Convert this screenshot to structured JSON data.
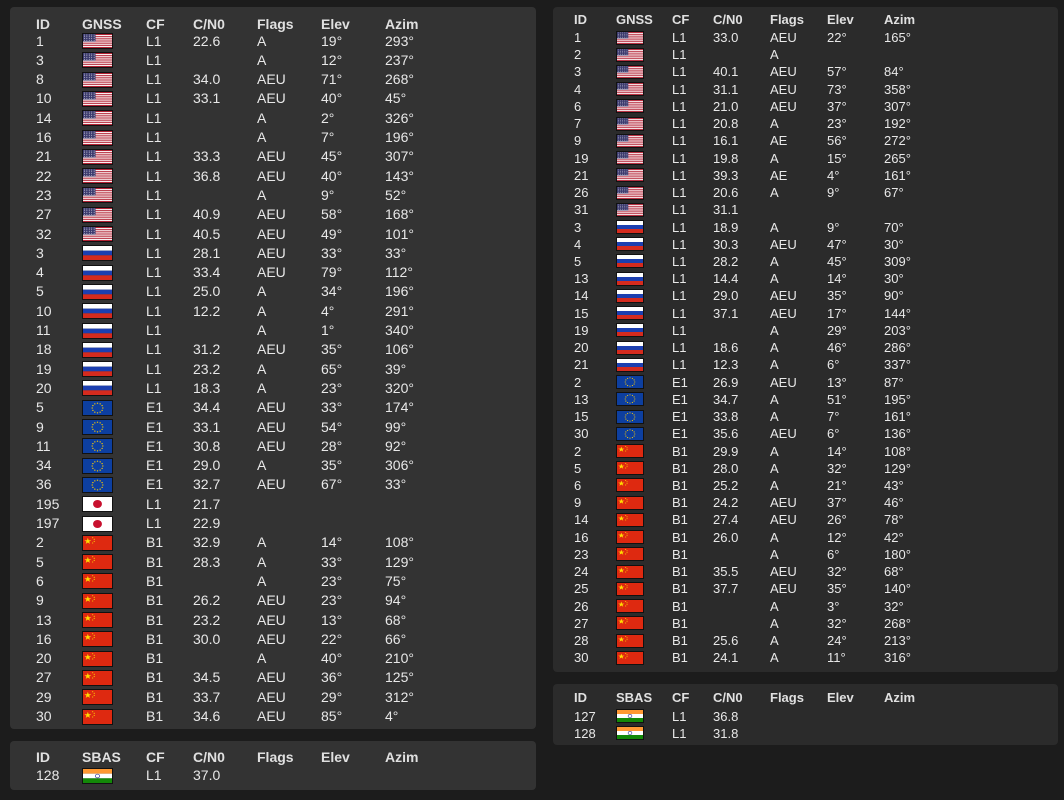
{
  "headers": {
    "id": "ID",
    "gnss": "GNSS",
    "sbas": "SBAS",
    "cf": "CF",
    "cn0": "C/N0",
    "flags": "Flags",
    "elev": "Elev",
    "azim": "Azim"
  },
  "colors": {
    "background": "#1c1c1c",
    "panel": "#333333",
    "text": "#e8e8e8"
  },
  "flag_icons": {
    "us": "us-flag-icon",
    "ru": "russia-flag-icon",
    "eu": "eu-flag-icon",
    "jp": "japan-flag-icon",
    "cn": "china-flag-icon",
    "in": "india-flag-icon"
  },
  "left_gnss_table": [
    {
      "id": "1",
      "flag": "us",
      "cf": "L1",
      "cn0": "22.6",
      "flags": "A",
      "elev": "19°",
      "azim": "293°"
    },
    {
      "id": "3",
      "flag": "us",
      "cf": "L1",
      "cn0": "",
      "flags": "A",
      "elev": "12°",
      "azim": "237°"
    },
    {
      "id": "8",
      "flag": "us",
      "cf": "L1",
      "cn0": "34.0",
      "flags": "AEU",
      "elev": "71°",
      "azim": "268°"
    },
    {
      "id": "10",
      "flag": "us",
      "cf": "L1",
      "cn0": "33.1",
      "flags": "AEU",
      "elev": "40°",
      "azim": "45°"
    },
    {
      "id": "14",
      "flag": "us",
      "cf": "L1",
      "cn0": "",
      "flags": "A",
      "elev": "2°",
      "azim": "326°"
    },
    {
      "id": "16",
      "flag": "us",
      "cf": "L1",
      "cn0": "",
      "flags": "A",
      "elev": "7°",
      "azim": "196°"
    },
    {
      "id": "21",
      "flag": "us",
      "cf": "L1",
      "cn0": "33.3",
      "flags": "AEU",
      "elev": "45°",
      "azim": "307°"
    },
    {
      "id": "22",
      "flag": "us",
      "cf": "L1",
      "cn0": "36.8",
      "flags": "AEU",
      "elev": "40°",
      "azim": "143°"
    },
    {
      "id": "23",
      "flag": "us",
      "cf": "L1",
      "cn0": "",
      "flags": "A",
      "elev": "9°",
      "azim": "52°"
    },
    {
      "id": "27",
      "flag": "us",
      "cf": "L1",
      "cn0": "40.9",
      "flags": "AEU",
      "elev": "58°",
      "azim": "168°"
    },
    {
      "id": "32",
      "flag": "us",
      "cf": "L1",
      "cn0": "40.5",
      "flags": "AEU",
      "elev": "49°",
      "azim": "101°"
    },
    {
      "id": "3",
      "flag": "ru",
      "cf": "L1",
      "cn0": "28.1",
      "flags": "AEU",
      "elev": "33°",
      "azim": "33°"
    },
    {
      "id": "4",
      "flag": "ru",
      "cf": "L1",
      "cn0": "33.4",
      "flags": "AEU",
      "elev": "79°",
      "azim": "112°"
    },
    {
      "id": "5",
      "flag": "ru",
      "cf": "L1",
      "cn0": "25.0",
      "flags": "A",
      "elev": "34°",
      "azim": "196°"
    },
    {
      "id": "10",
      "flag": "ru",
      "cf": "L1",
      "cn0": "12.2",
      "flags": "A",
      "elev": "4°",
      "azim": "291°"
    },
    {
      "id": "11",
      "flag": "ru",
      "cf": "L1",
      "cn0": "",
      "flags": "A",
      "elev": "1°",
      "azim": "340°"
    },
    {
      "id": "18",
      "flag": "ru",
      "cf": "L1",
      "cn0": "31.2",
      "flags": "AEU",
      "elev": "35°",
      "azim": "106°"
    },
    {
      "id": "19",
      "flag": "ru",
      "cf": "L1",
      "cn0": "23.2",
      "flags": "A",
      "elev": "65°",
      "azim": "39°"
    },
    {
      "id": "20",
      "flag": "ru",
      "cf": "L1",
      "cn0": "18.3",
      "flags": "A",
      "elev": "23°",
      "azim": "320°"
    },
    {
      "id": "5",
      "flag": "eu",
      "cf": "E1",
      "cn0": "34.4",
      "flags": "AEU",
      "elev": "33°",
      "azim": "174°"
    },
    {
      "id": "9",
      "flag": "eu",
      "cf": "E1",
      "cn0": "33.1",
      "flags": "AEU",
      "elev": "54°",
      "azim": "99°"
    },
    {
      "id": "11",
      "flag": "eu",
      "cf": "E1",
      "cn0": "30.8",
      "flags": "AEU",
      "elev": "28°",
      "azim": "92°"
    },
    {
      "id": "34",
      "flag": "eu",
      "cf": "E1",
      "cn0": "29.0",
      "flags": "A",
      "elev": "35°",
      "azim": "306°"
    },
    {
      "id": "36",
      "flag": "eu",
      "cf": "E1",
      "cn0": "32.7",
      "flags": "AEU",
      "elev": "67°",
      "azim": "33°"
    },
    {
      "id": "195",
      "flag": "jp",
      "cf": "L1",
      "cn0": "21.7",
      "flags": "",
      "elev": "",
      "azim": ""
    },
    {
      "id": "197",
      "flag": "jp",
      "cf": "L1",
      "cn0": "22.9",
      "flags": "",
      "elev": "",
      "azim": ""
    },
    {
      "id": "2",
      "flag": "cn",
      "cf": "B1",
      "cn0": "32.9",
      "flags": "A",
      "elev": "14°",
      "azim": "108°"
    },
    {
      "id": "5",
      "flag": "cn",
      "cf": "B1",
      "cn0": "28.3",
      "flags": "A",
      "elev": "33°",
      "azim": "129°"
    },
    {
      "id": "6",
      "flag": "cn",
      "cf": "B1",
      "cn0": "",
      "flags": "A",
      "elev": "23°",
      "azim": "75°"
    },
    {
      "id": "9",
      "flag": "cn",
      "cf": "B1",
      "cn0": "26.2",
      "flags": "AEU",
      "elev": "23°",
      "azim": "94°"
    },
    {
      "id": "13",
      "flag": "cn",
      "cf": "B1",
      "cn0": "23.2",
      "flags": "AEU",
      "elev": "13°",
      "azim": "68°"
    },
    {
      "id": "16",
      "flag": "cn",
      "cf": "B1",
      "cn0": "30.0",
      "flags": "AEU",
      "elev": "22°",
      "azim": "66°"
    },
    {
      "id": "20",
      "flag": "cn",
      "cf": "B1",
      "cn0": "",
      "flags": "A",
      "elev": "40°",
      "azim": "210°"
    },
    {
      "id": "27",
      "flag": "cn",
      "cf": "B1",
      "cn0": "34.5",
      "flags": "AEU",
      "elev": "36°",
      "azim": "125°"
    },
    {
      "id": "29",
      "flag": "cn",
      "cf": "B1",
      "cn0": "33.7",
      "flags": "AEU",
      "elev": "29°",
      "azim": "312°"
    },
    {
      "id": "30",
      "flag": "cn",
      "cf": "B1",
      "cn0": "34.6",
      "flags": "AEU",
      "elev": "85°",
      "azim": "4°"
    }
  ],
  "left_sbas_table": [
    {
      "id": "128",
      "flag": "in",
      "cf": "L1",
      "cn0": "37.0",
      "flags": "",
      "elev": "",
      "azim": ""
    }
  ],
  "right_gnss_table": [
    {
      "id": "1",
      "flag": "us",
      "cf": "L1",
      "cn0": "33.0",
      "flags": "AEU",
      "elev": "22°",
      "azim": "165°"
    },
    {
      "id": "2",
      "flag": "us",
      "cf": "L1",
      "cn0": "",
      "flags": "A",
      "elev": "",
      "azim": ""
    },
    {
      "id": "3",
      "flag": "us",
      "cf": "L1",
      "cn0": "40.1",
      "flags": "AEU",
      "elev": "57°",
      "azim": "84°"
    },
    {
      "id": "4",
      "flag": "us",
      "cf": "L1",
      "cn0": "31.1",
      "flags": "AEU",
      "elev": "73°",
      "azim": "358°"
    },
    {
      "id": "6",
      "flag": "us",
      "cf": "L1",
      "cn0": "21.0",
      "flags": "AEU",
      "elev": "37°",
      "azim": "307°"
    },
    {
      "id": "7",
      "flag": "us",
      "cf": "L1",
      "cn0": "20.8",
      "flags": "A",
      "elev": "23°",
      "azim": "192°"
    },
    {
      "id": "9",
      "flag": "us",
      "cf": "L1",
      "cn0": "16.1",
      "flags": "AE",
      "elev": "56°",
      "azim": "272°"
    },
    {
      "id": "19",
      "flag": "us",
      "cf": "L1",
      "cn0": "19.8",
      "flags": "A",
      "elev": "15°",
      "azim": "265°"
    },
    {
      "id": "21",
      "flag": "us",
      "cf": "L1",
      "cn0": "39.3",
      "flags": "AE",
      "elev": "4°",
      "azim": "161°"
    },
    {
      "id": "26",
      "flag": "us",
      "cf": "L1",
      "cn0": "20.6",
      "flags": "A",
      "elev": "9°",
      "azim": "67°"
    },
    {
      "id": "31",
      "flag": "us",
      "cf": "L1",
      "cn0": "31.1",
      "flags": "",
      "elev": "",
      "azim": ""
    },
    {
      "id": "3",
      "flag": "ru",
      "cf": "L1",
      "cn0": "18.9",
      "flags": "A",
      "elev": "9°",
      "azim": "70°"
    },
    {
      "id": "4",
      "flag": "ru",
      "cf": "L1",
      "cn0": "30.3",
      "flags": "AEU",
      "elev": "47°",
      "azim": "30°"
    },
    {
      "id": "5",
      "flag": "ru",
      "cf": "L1",
      "cn0": "28.2",
      "flags": "A",
      "elev": "45°",
      "azim": "309°"
    },
    {
      "id": "13",
      "flag": "ru",
      "cf": "L1",
      "cn0": "14.4",
      "flags": "A",
      "elev": "14°",
      "azim": "30°"
    },
    {
      "id": "14",
      "flag": "ru",
      "cf": "L1",
      "cn0": "29.0",
      "flags": "AEU",
      "elev": "35°",
      "azim": "90°"
    },
    {
      "id": "15",
      "flag": "ru",
      "cf": "L1",
      "cn0": "37.1",
      "flags": "AEU",
      "elev": "17°",
      "azim": "144°"
    },
    {
      "id": "19",
      "flag": "ru",
      "cf": "L1",
      "cn0": "",
      "flags": "A",
      "elev": "29°",
      "azim": "203°"
    },
    {
      "id": "20",
      "flag": "ru",
      "cf": "L1",
      "cn0": "18.6",
      "flags": "A",
      "elev": "46°",
      "azim": "286°"
    },
    {
      "id": "21",
      "flag": "ru",
      "cf": "L1",
      "cn0": "12.3",
      "flags": "A",
      "elev": "6°",
      "azim": "337°"
    },
    {
      "id": "2",
      "flag": "eu",
      "cf": "E1",
      "cn0": "26.9",
      "flags": "AEU",
      "elev": "13°",
      "azim": "87°"
    },
    {
      "id": "13",
      "flag": "eu",
      "cf": "E1",
      "cn0": "34.7",
      "flags": "A",
      "elev": "51°",
      "azim": "195°"
    },
    {
      "id": "15",
      "flag": "eu",
      "cf": "E1",
      "cn0": "33.8",
      "flags": "A",
      "elev": "7°",
      "azim": "161°"
    },
    {
      "id": "30",
      "flag": "eu",
      "cf": "E1",
      "cn0": "35.6",
      "flags": "AEU",
      "elev": "6°",
      "azim": "136°"
    },
    {
      "id": "2",
      "flag": "cn",
      "cf": "B1",
      "cn0": "29.9",
      "flags": "A",
      "elev": "14°",
      "azim": "108°"
    },
    {
      "id": "5",
      "flag": "cn",
      "cf": "B1",
      "cn0": "28.0",
      "flags": "A",
      "elev": "32°",
      "azim": "129°"
    },
    {
      "id": "6",
      "flag": "cn",
      "cf": "B1",
      "cn0": "25.2",
      "flags": "A",
      "elev": "21°",
      "azim": "43°"
    },
    {
      "id": "9",
      "flag": "cn",
      "cf": "B1",
      "cn0": "24.2",
      "flags": "AEU",
      "elev": "37°",
      "azim": "46°"
    },
    {
      "id": "14",
      "flag": "cn",
      "cf": "B1",
      "cn0": "27.4",
      "flags": "AEU",
      "elev": "26°",
      "azim": "78°"
    },
    {
      "id": "16",
      "flag": "cn",
      "cf": "B1",
      "cn0": "26.0",
      "flags": "A",
      "elev": "12°",
      "azim": "42°"
    },
    {
      "id": "23",
      "flag": "cn",
      "cf": "B1",
      "cn0": "",
      "flags": "A",
      "elev": "6°",
      "azim": "180°"
    },
    {
      "id": "24",
      "flag": "cn",
      "cf": "B1",
      "cn0": "35.5",
      "flags": "AEU",
      "elev": "32°",
      "azim": "68°"
    },
    {
      "id": "25",
      "flag": "cn",
      "cf": "B1",
      "cn0": "37.7",
      "flags": "AEU",
      "elev": "35°",
      "azim": "140°"
    },
    {
      "id": "26",
      "flag": "cn",
      "cf": "B1",
      "cn0": "",
      "flags": "A",
      "elev": "3°",
      "azim": "32°"
    },
    {
      "id": "27",
      "flag": "cn",
      "cf": "B1",
      "cn0": "",
      "flags": "A",
      "elev": "32°",
      "azim": "268°"
    },
    {
      "id": "28",
      "flag": "cn",
      "cf": "B1",
      "cn0": "25.6",
      "flags": "A",
      "elev": "24°",
      "azim": "213°"
    },
    {
      "id": "30",
      "flag": "cn",
      "cf": "B1",
      "cn0": "24.1",
      "flags": "A",
      "elev": "11°",
      "azim": "316°"
    }
  ],
  "right_sbas_table": [
    {
      "id": "127",
      "flag": "in",
      "cf": "L1",
      "cn0": "36.8",
      "flags": "",
      "elev": "",
      "azim": ""
    },
    {
      "id": "128",
      "flag": "in",
      "cf": "L1",
      "cn0": "31.8",
      "flags": "",
      "elev": "",
      "azim": ""
    }
  ]
}
